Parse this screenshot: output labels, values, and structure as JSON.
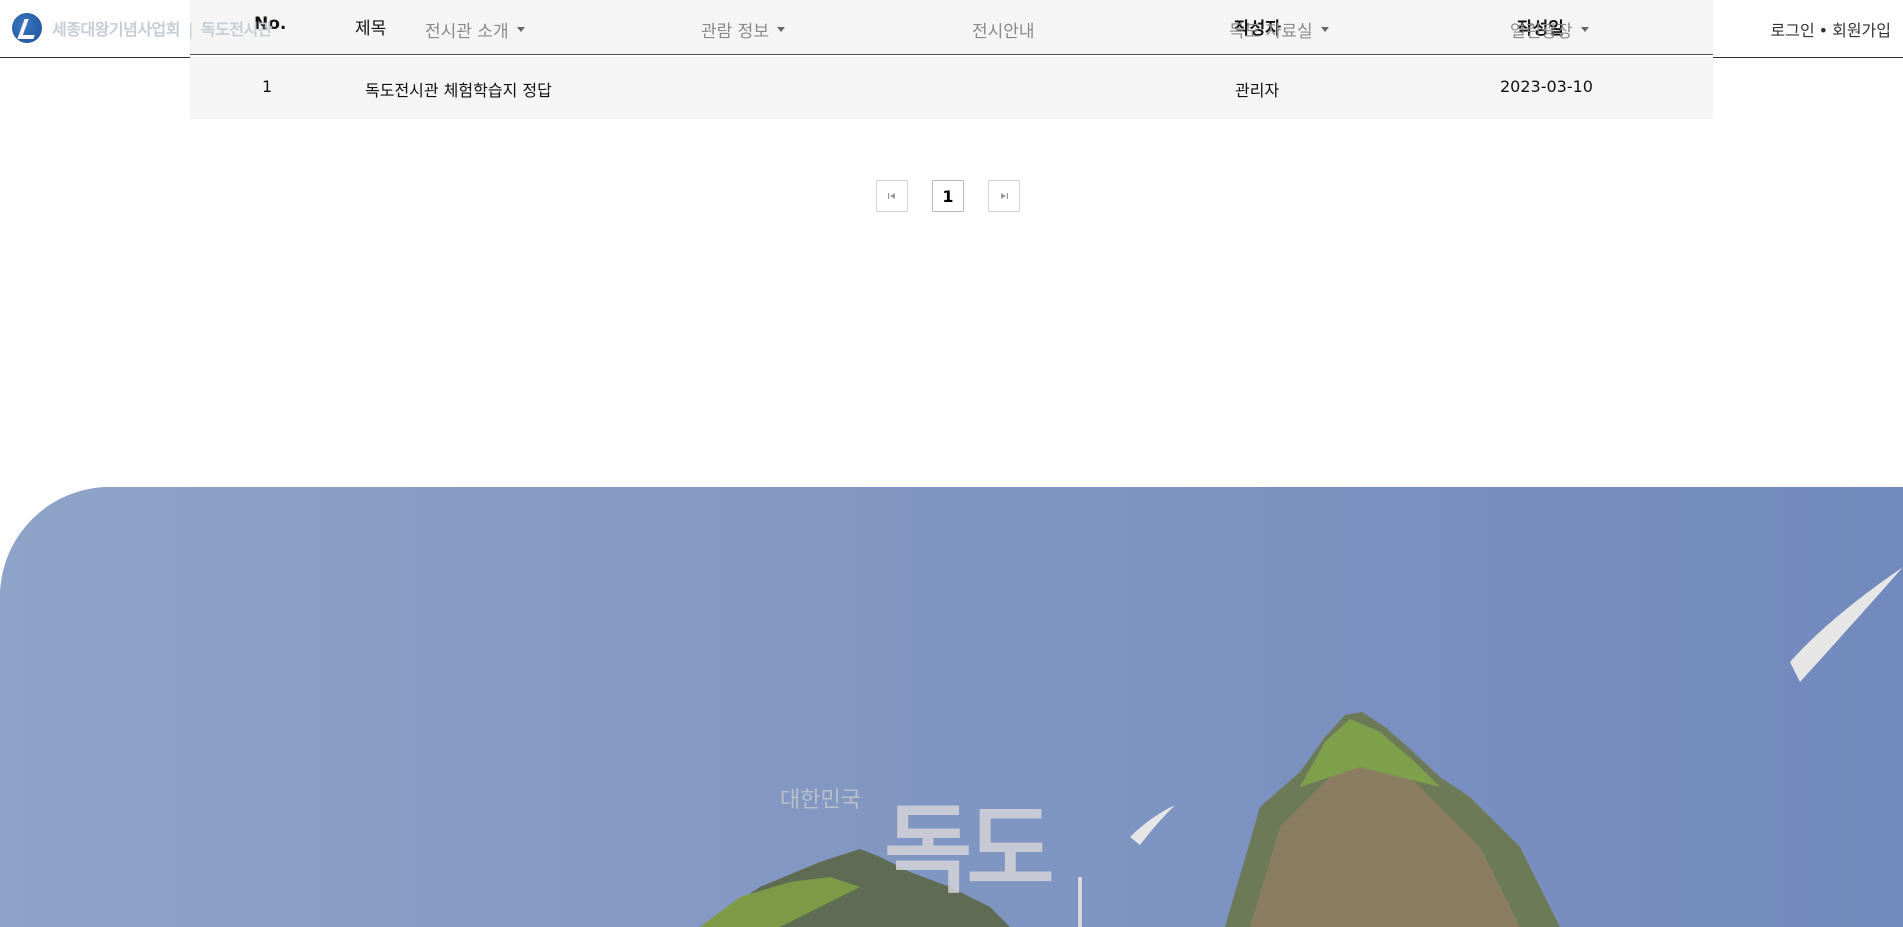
{
  "header": {
    "logo_text": "세종대왕기념사업회",
    "logo_sub": "독도전시관",
    "nav": [
      {
        "label": "전시관 소개",
        "has_dropdown": true
      },
      {
        "label": "관람 정보",
        "has_dropdown": true
      },
      {
        "label": "전시안내",
        "has_dropdown": false
      },
      {
        "label": "독도 자료실",
        "has_dropdown": true
      },
      {
        "label": "열린광장",
        "has_dropdown": true
      }
    ],
    "login_label": "로그인",
    "separator": "•",
    "signup_label": "회원가입"
  },
  "table": {
    "columns": [
      "No.",
      "제목",
      "작성자",
      "작성일"
    ],
    "rows": [
      {
        "no": "1",
        "title": "독도전시관 체험학습지 정답",
        "writer": "관리자",
        "date": "2023-03-10"
      }
    ]
  },
  "pagination": {
    "first_icon": "first-page-icon",
    "current_page": "1",
    "last_icon": "last-page-icon"
  },
  "banner": {
    "subtitle": "대한민국",
    "title": "독도"
  },
  "colors": {
    "sky": "#8aa0c6",
    "table_bg": "#f5f5f5",
    "nav_text": "#8a8a8a"
  }
}
